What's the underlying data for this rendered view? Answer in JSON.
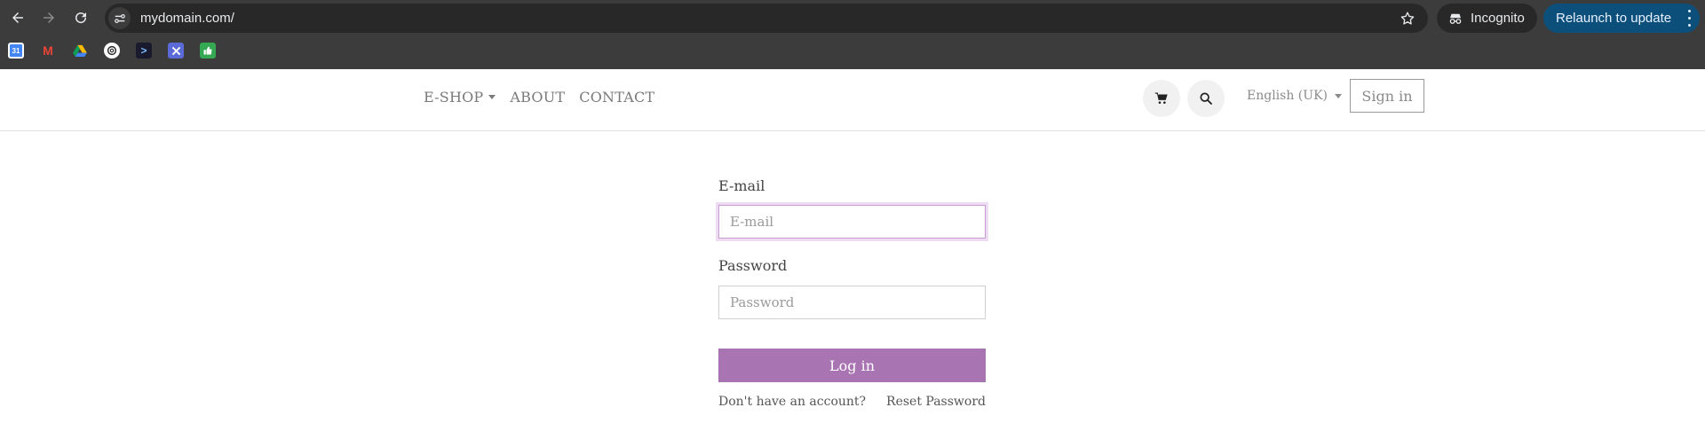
{
  "browser": {
    "url": "mydomain.com/",
    "incognito_label": "Incognito",
    "relaunch_label": "Relaunch to update",
    "bookmarks": [
      {
        "icon": "calendar-icon",
        "text": "31"
      },
      {
        "icon": "gmail-icon",
        "text": "M"
      },
      {
        "icon": "drive-icon",
        "text": ""
      },
      {
        "icon": "openai-icon",
        "text": ""
      },
      {
        "icon": "terminal-icon",
        "text": ">"
      },
      {
        "icon": "tools-icon",
        "text": ""
      },
      {
        "icon": "thumbs-up-icon",
        "text": ""
      }
    ]
  },
  "site": {
    "nav": {
      "eshop": "E-SHOP",
      "about": "ABOUT",
      "contact": "CONTACT"
    },
    "language": "English (UK)",
    "signin": "Sign in"
  },
  "login": {
    "email_label": "E-mail",
    "email_placeholder": "E-mail",
    "email_value": "",
    "password_label": "Password",
    "password_placeholder": "Password",
    "password_value": "",
    "login_button": "Log in",
    "no_account_link": "Don't have an account?",
    "reset_link": "Reset Password"
  },
  "colors": {
    "accent": "#a974b2",
    "focus_ring": "#eedcf2",
    "relaunch_bg": "#0b4f7a"
  }
}
